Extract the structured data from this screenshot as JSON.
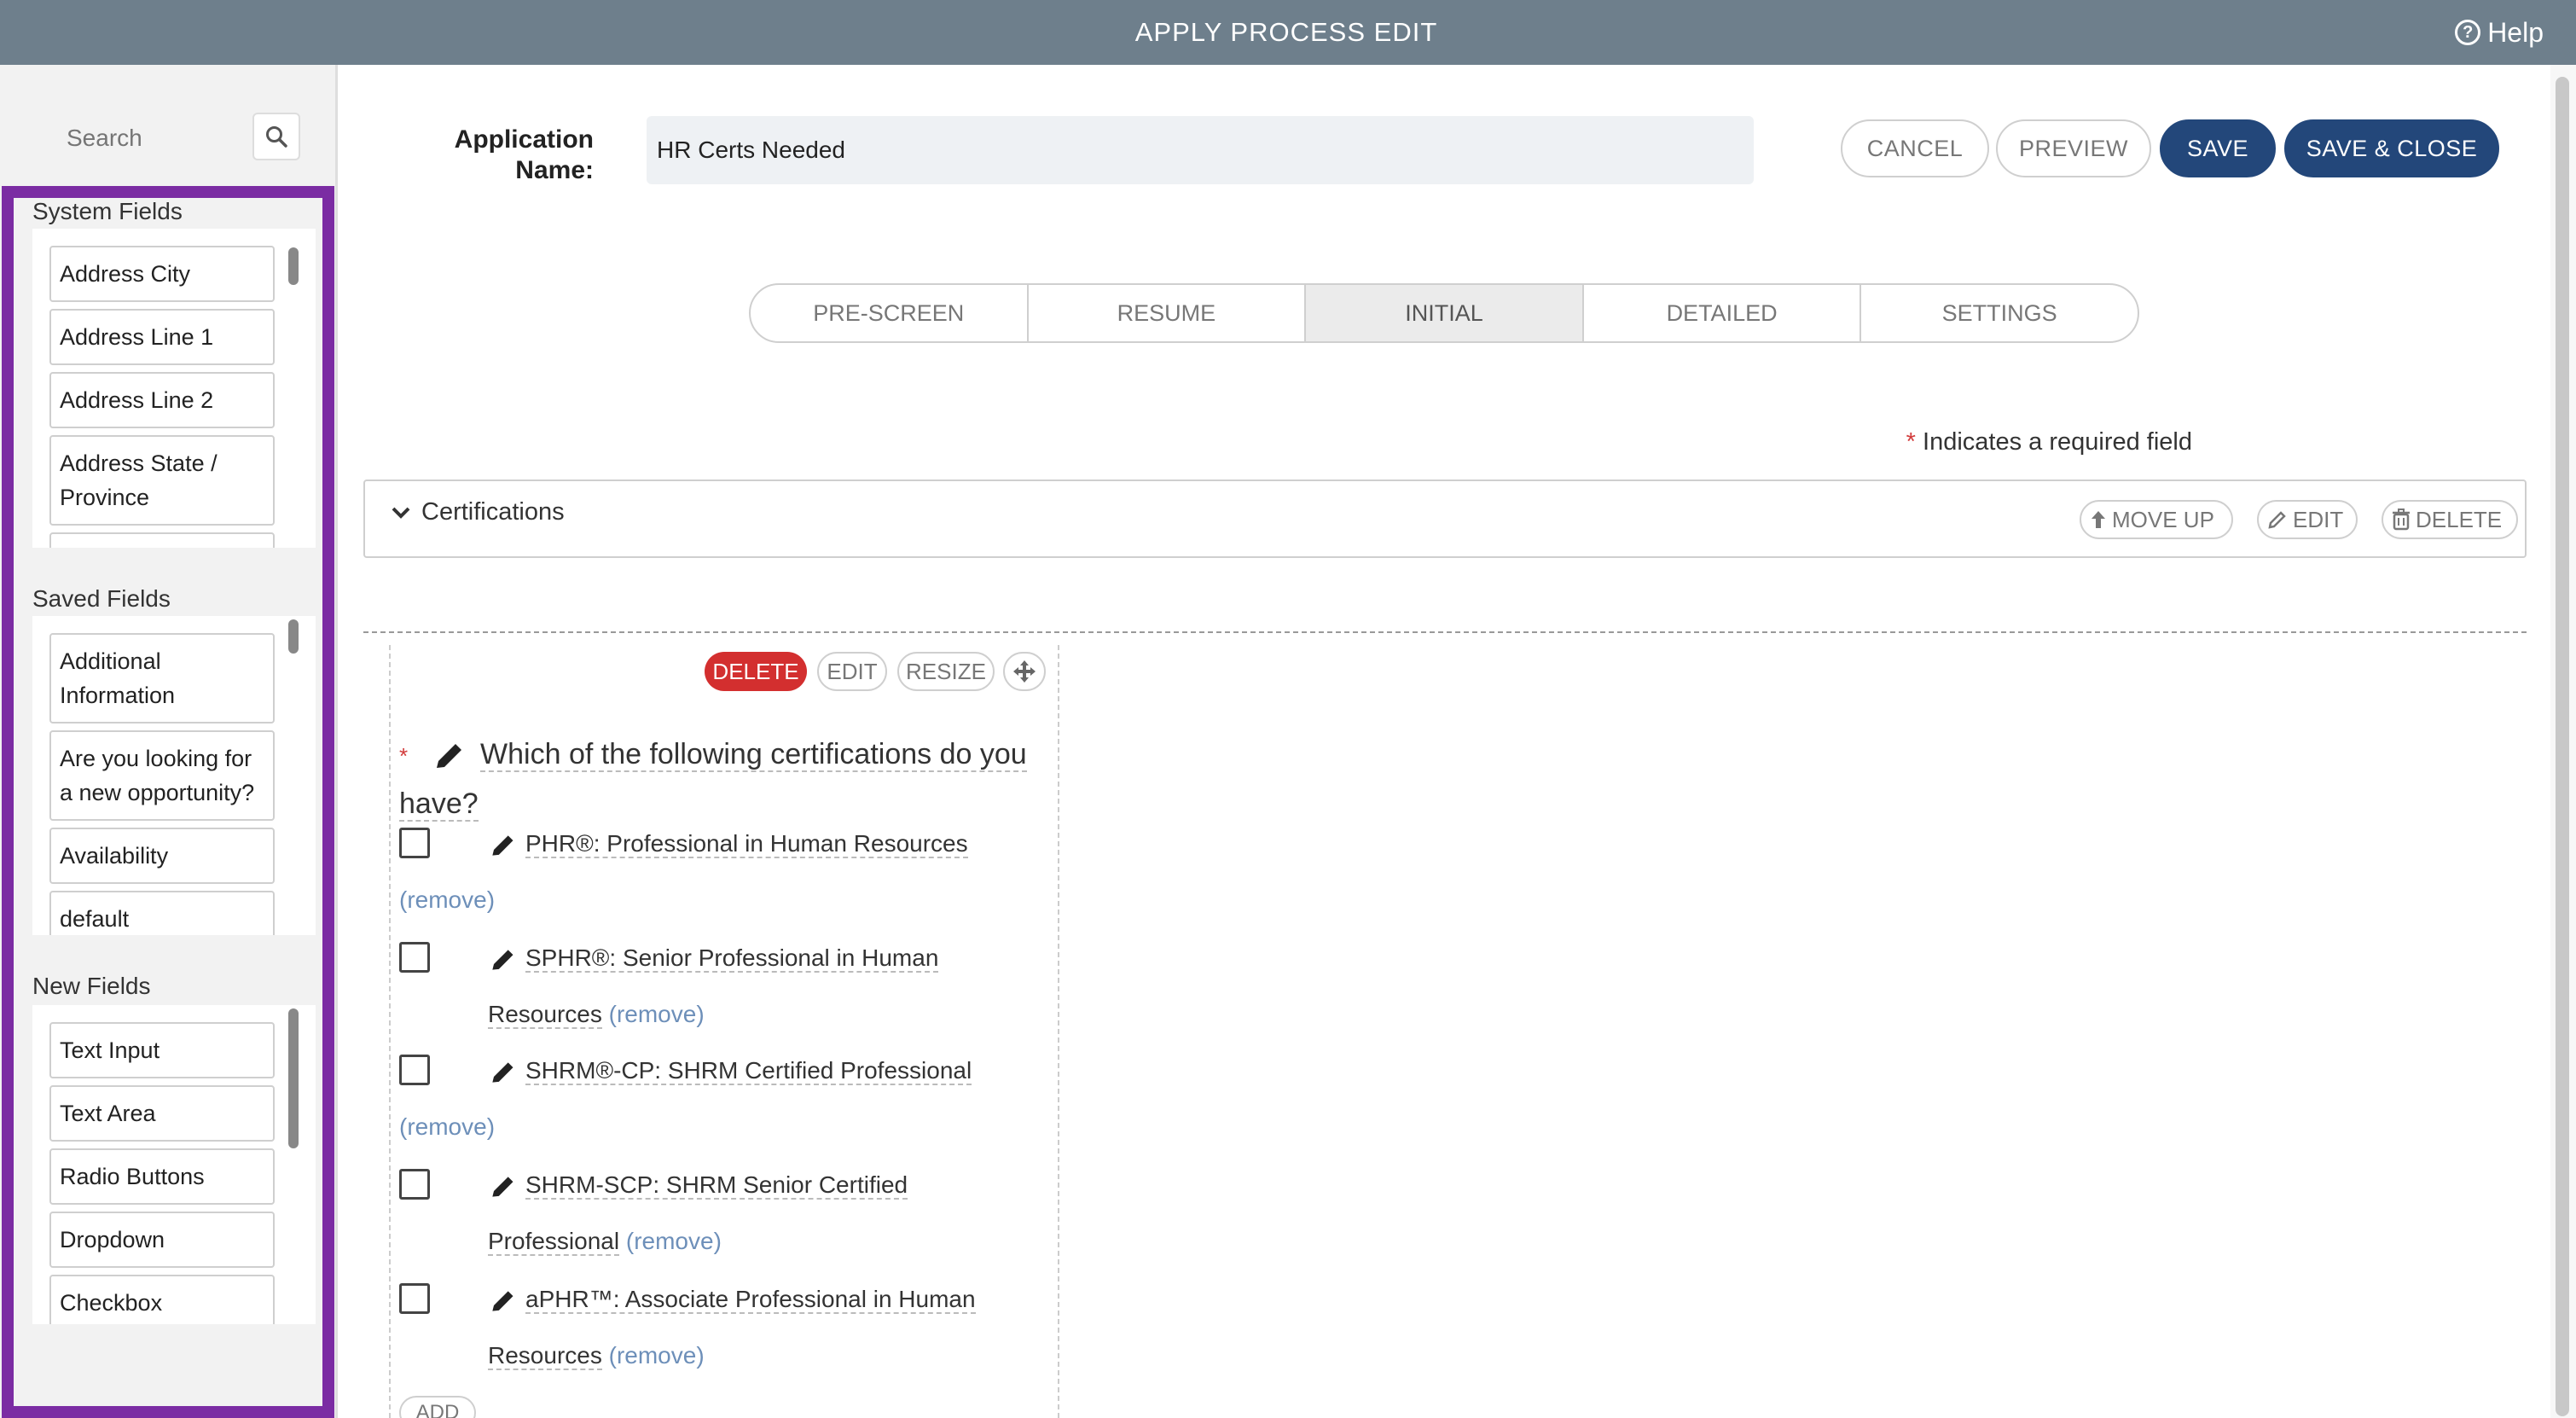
{
  "header": {
    "title": "APPLY PROCESS EDIT",
    "help_label": "Help"
  },
  "sidebar": {
    "search_placeholder": "Search",
    "groups": [
      {
        "title": "System Fields",
        "items": [
          "Address City",
          "Address Line 1",
          "Address Line 2",
          "Address State / Province"
        ]
      },
      {
        "title": "Saved Fields",
        "items": [
          "Additional Information",
          "Are you looking for a new opportunity?",
          "Availability",
          "default"
        ]
      },
      {
        "title": "New Fields",
        "items": [
          "Text Input",
          "Text Area",
          "Radio Buttons",
          "Dropdown",
          "Checkbox"
        ]
      }
    ]
  },
  "form": {
    "app_name_label": "Application Name:",
    "app_name_value": "HR Certs Needed",
    "buttons": {
      "cancel": "CANCEL",
      "preview": "PREVIEW",
      "save": "SAVE",
      "save_close": "SAVE & CLOSE"
    }
  },
  "tabs": [
    {
      "label": "PRE-SCREEN",
      "active": false
    },
    {
      "label": "RESUME",
      "active": false
    },
    {
      "label": "INITIAL",
      "active": true
    },
    {
      "label": "DETAILED",
      "active": false
    },
    {
      "label": "SETTINGS",
      "active": false
    }
  ],
  "required_note": {
    "star": "*",
    "text": "Indicates a required field"
  },
  "section": {
    "title": "Certifications",
    "move_up": "MOVE UP",
    "edit": "EDIT",
    "delete": "DELETE"
  },
  "field": {
    "delete": "DELETE",
    "edit": "EDIT",
    "resize": "RESIZE",
    "required_star": "*",
    "question": "Which of the following certifications do you have?",
    "remove_label": "(remove)",
    "add_label": "ADD",
    "options": [
      "PHR®: Professional in Human Resources",
      "SPHR®: Senior Professional in Human Resources",
      "SHRM®-CP: SHRM Certified Professional",
      "SHRM-SCP: SHRM Senior Certified Professional",
      "aPHR™: Associate Professional in Human Resources"
    ]
  },
  "colors": {
    "topbar": "#6e7f8c",
    "primary": "#23477a",
    "danger": "#d32f2f",
    "palette_border": "#7b2ca3",
    "link": "#6d8fb9"
  }
}
